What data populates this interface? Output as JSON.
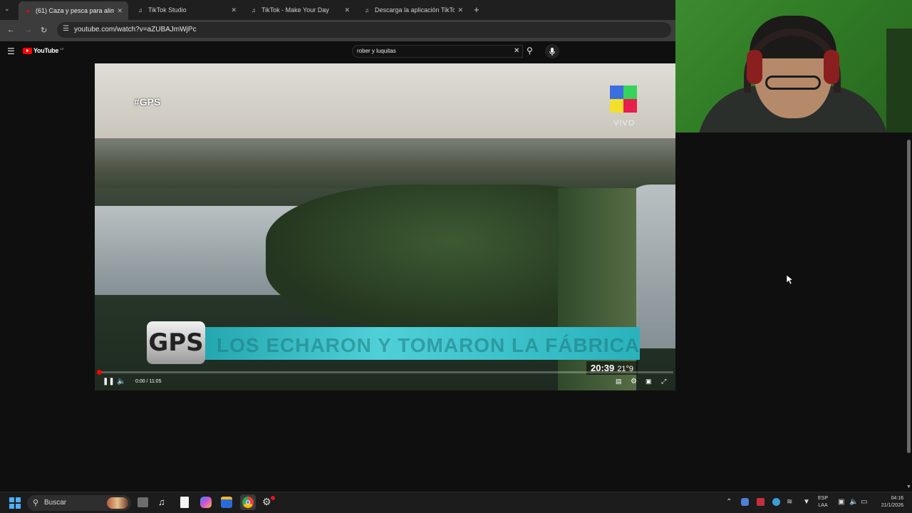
{
  "browser": {
    "tabs": [
      {
        "label": "(61) Caza y pesca para alim",
        "active": true,
        "icon": "youtube-icon"
      },
      {
        "label": "TikTok Studio",
        "active": false,
        "icon": "tiktok-icon"
      },
      {
        "label": "TikTok - Make Your Day",
        "active": false,
        "icon": "tiktok-icon"
      },
      {
        "label": "Descarga la aplicación TikTok p",
        "active": false,
        "icon": "tiktok-icon"
      }
    ],
    "new_tab": "+",
    "url": "youtube.com/watch?v=aZUBAJmWjPc"
  },
  "youtube": {
    "logo": "YouTube",
    "logo_region": "AR",
    "search_value": "rober y luquitas"
  },
  "video": {
    "hashtag": "#GPS",
    "channel_bug": "VIVO",
    "lower_third_logo": "GPS",
    "headline": "LOS ECHARON Y TOMARON LA FÁBRICA",
    "tv_clock": "20:39",
    "tv_temp": "21°9",
    "time_display": "0:00 / 11:05",
    "progress": 0.0
  },
  "taskbar": {
    "search_placeholder": "Buscar",
    "lang_top": "ESP",
    "lang_bottom": "LAA",
    "time": "04:16",
    "date": "21/1/2026"
  },
  "colors": {
    "accent_red": "#ff0000",
    "gps_cyan": "#3cc3cc"
  }
}
